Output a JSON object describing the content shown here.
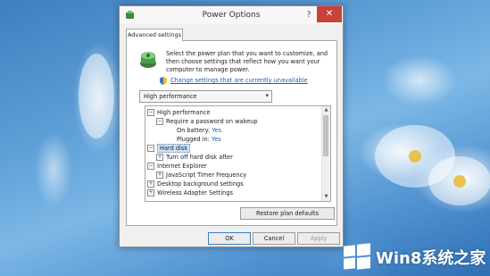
{
  "window": {
    "title": "Power Options",
    "help_glyph": "?",
    "close_glyph": "✕",
    "tab_label": "Advanced settings",
    "intro_text": "Select the power plan that you want to customize, and then choose settings that reflect how you want your computer to manage power.",
    "change_link": "Change settings that are currently unavailable",
    "plan_select": {
      "value": "High performance",
      "arrow": "▾"
    },
    "tree": [
      {
        "toggle": "−",
        "label": "High performance"
      },
      {
        "toggle": "−",
        "label": "Require a password on wakeup"
      },
      {
        "label": "On battery:",
        "value": "Yes"
      },
      {
        "label": "Plugged in:",
        "value": "Yes"
      },
      {
        "toggle": "−",
        "label": "Hard disk"
      },
      {
        "toggle": "+",
        "label": "Turn off hard disk after"
      },
      {
        "toggle": "−",
        "label": "Internet Explorer"
      },
      {
        "toggle": "+",
        "label": "JavaScript Timer Frequency"
      },
      {
        "toggle": "+",
        "label": "Desktop background settings"
      },
      {
        "toggle": "+",
        "label": "Wireless Adapter Settings"
      }
    ],
    "restore_label": "Restore plan defaults",
    "buttons": {
      "ok": "OK",
      "cancel": "Cancel",
      "apply": "Apply"
    }
  },
  "watermark": {
    "text": "Win8系统之家",
    "icon": "windows-logo-icon"
  },
  "colors": {
    "close_red": "#c8423a",
    "link_blue": "#1a5fb4",
    "selection": "#cfe3f7"
  }
}
